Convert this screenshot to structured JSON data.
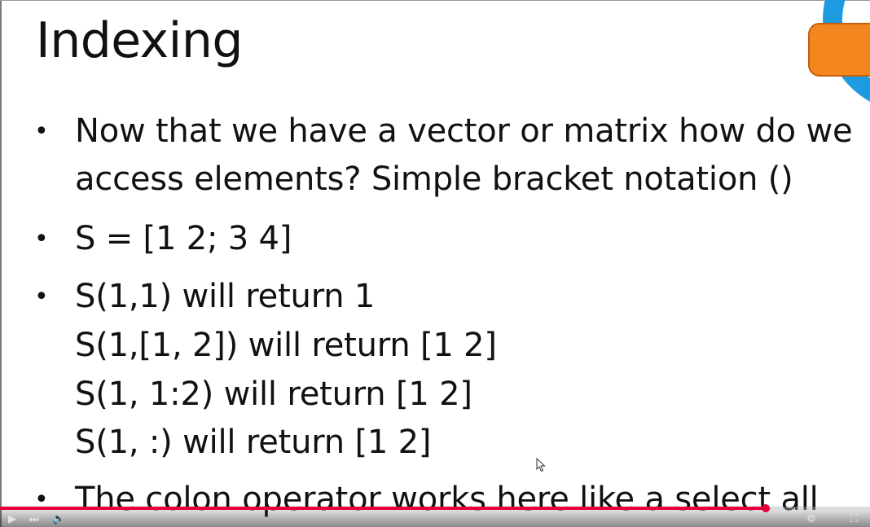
{
  "slide": {
    "title": "Indexing",
    "bullets": [
      {
        "marker": "•",
        "lines": [
          "Now that we have a vector or matrix how do we",
          "access elements? Simple bracket notation ()"
        ]
      },
      {
        "marker": "•",
        "lines": [
          "S = [1 2; 3 4]"
        ]
      },
      {
        "marker": "•",
        "lines": [
          "S(1,1) will return 1",
          "S(1,[1, 2]) will return [1 2]",
          "S(1, 1:2) will return [1 2]",
          "S(1, :) will return [1 2]"
        ]
      },
      {
        "marker": "•",
        "lines": [
          "The colon operator works here like a select all"
        ]
      }
    ]
  },
  "player": {
    "progress_fraction": 0.88,
    "accent_color": "#e8003a",
    "icons": [
      "play-icon",
      "next-icon",
      "volume-icon",
      "settings-icon",
      "fullscreen-icon"
    ]
  },
  "theme": {
    "decoration_blue": "#1e9be0",
    "decoration_orange": "#f3861f"
  }
}
